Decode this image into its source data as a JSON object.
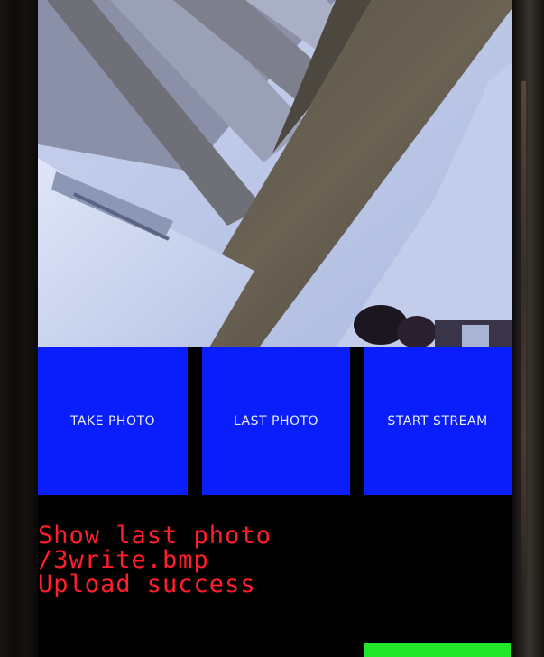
{
  "buttons": {
    "take_photo": "TAKE PHOTO",
    "last_photo": "LAST PHOTO",
    "start_stream": "START STREAM"
  },
  "status_lines": [
    "Show last photo",
    "/3write.bmp",
    "Upload success"
  ],
  "colors": {
    "button_bg": "#0a1dfb",
    "status_text": "#ff1e2a",
    "indicator": "#22e62a"
  }
}
